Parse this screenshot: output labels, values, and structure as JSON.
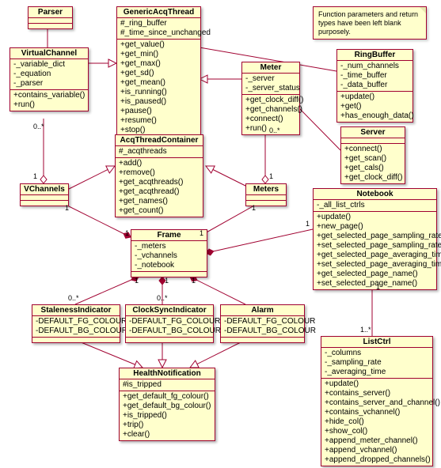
{
  "note": "Function parameters and return types have been left blank purposely.",
  "classes": {
    "Parser": {
      "title": "Parser",
      "attrs": [],
      "ops": []
    },
    "VirtualChannel": {
      "title": "VirtualChannel",
      "attrs": [
        "-_variable_dict",
        "-_equation",
        "-_parser"
      ],
      "ops": [
        "+contains_variable()",
        "+run()"
      ]
    },
    "GenericAcqThread": {
      "title": "GenericAcqThread",
      "attrs": [
        "#_ring_buffer",
        "#_time_since_unchanged"
      ],
      "ops": [
        "+get_value()",
        "+get_min()",
        "+get_max()",
        "+get_sd()",
        "+get_mean()",
        "+is_running()",
        "+is_paused()",
        "+pause()",
        "+resume()",
        "+stop()"
      ]
    },
    "Meter": {
      "title": "Meter",
      "attrs": [
        "-_server",
        "-_server_status"
      ],
      "ops": [
        "+get_clock_diff()",
        "+get_channels()",
        "+connect()",
        "+run()"
      ]
    },
    "RingBuffer": {
      "title": "RingBuffer",
      "attrs": [
        "-_num_channels",
        "-_time_buffer",
        "-_data_buffer"
      ],
      "ops": [
        "+update()",
        "+get()",
        "+has_enough_data()"
      ]
    },
    "Server": {
      "title": "Server",
      "attrs": [],
      "ops": [
        "+connect()",
        "+get_scan()",
        "+get_cals()",
        "+get_clock_diff()"
      ]
    },
    "AcqThreadContainer": {
      "title": "AcqThreadContainer",
      "attrs": [
        "#_acqthreads"
      ],
      "ops": [
        "+add()",
        "+remove()",
        "+get_acqthreads()",
        "+get_acqthread()",
        "+get_names()",
        "+get_count()"
      ]
    },
    "VChannels": {
      "title": "VChannels",
      "attrs": [],
      "ops": []
    },
    "Meters": {
      "title": "Meters",
      "attrs": [],
      "ops": []
    },
    "Frame": {
      "title": "Frame",
      "attrs": [
        "-_meters",
        "-_vchannels",
        "-_notebook"
      ],
      "ops": []
    },
    "Notebook": {
      "title": "Notebook",
      "attrs": [
        "-_all_list_ctrls"
      ],
      "ops": [
        "+update()",
        "+new_page()",
        "+get_selected_page_sampling_rate()",
        "+set_selected_page_sampling_rate()",
        "+get_selected_page_averaging_time()",
        "+set_selected_page_averaging_time()",
        "+get_selected_page_name()",
        "+set_selected_page_name()"
      ]
    },
    "StalenessIndicator": {
      "title": "StalenessIndicator",
      "attrs": [
        "-DEFAULT_FG_COLOUR",
        "-DEFAULT_BG_COLOUR"
      ],
      "ops": []
    },
    "ClockSyncIndicator": {
      "title": "ClockSyncIndicator",
      "attrs": [
        "-DEFAULT_FG_COLOUR",
        "-DEFAULT_BG_COLOUR"
      ],
      "ops": []
    },
    "Alarm": {
      "title": "Alarm",
      "attrs": [
        "-DEFAULT_FG_COLOUR",
        "-DEFAULT_BG_COLOUR"
      ],
      "ops": []
    },
    "HealthNotification": {
      "title": "HealthNotification",
      "attrs": [
        "#is_tripped"
      ],
      "ops": [
        "+get_default_fg_colour()",
        "+get_default_bg_colour()",
        "+is_tripped()",
        "+trip()",
        "+clear()"
      ]
    },
    "ListCtrl": {
      "title": "ListCtrl",
      "attrs": [
        "-_columns",
        "-_sampling_rate",
        "-_averaging_time"
      ],
      "ops": [
        "+update()",
        "+contains_server()",
        "+contains_server_and_channel()",
        "+contains_vchannel()",
        "+hide_col()",
        "+show_col()",
        "+append_meter_channel()",
        "+append_vchannel()",
        "+append_dropped_channels()"
      ]
    }
  },
  "mults": {
    "m1": "0..*",
    "m2": "1",
    "m3": "0..*",
    "m4": "1",
    "m5": "1",
    "m6": "1",
    "m7": "1",
    "m8": "1",
    "m9": "1",
    "m10": "0..*",
    "m11": "1",
    "m12": "0..*",
    "m13": "1",
    "m14": "1",
    "m15": "1..*",
    "m16": "1"
  }
}
